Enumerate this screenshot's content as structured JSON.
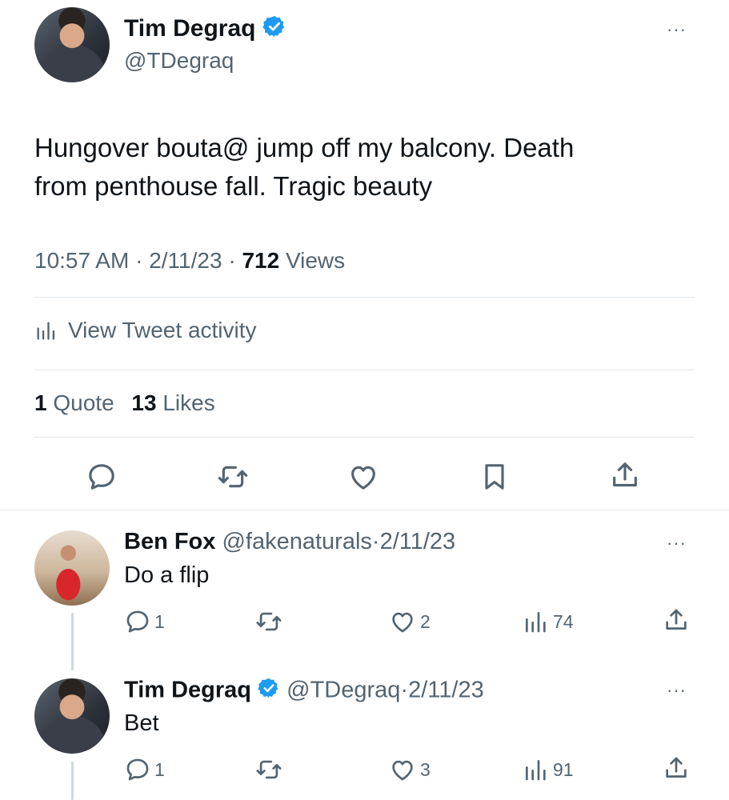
{
  "main_tweet": {
    "author_name": "Tim Degraq",
    "author_handle": "@TDegraq",
    "text_line1": "Hungover bouta@ jump off my balcony. Death",
    "text_line2": "from penthouse fall. Tragic beauty",
    "time": "10:57 AM",
    "date": "2/11/23",
    "views_count": "712",
    "views_label": "Views",
    "activity_label": "View Tweet activity",
    "quotes_count": "1",
    "quotes_label": "Quote",
    "likes_count": "13",
    "likes_label": "Likes"
  },
  "replies": [
    {
      "author_name": "Ben Fox",
      "author_handle": "@fakenaturals",
      "date": "2/11/23",
      "text": "Do a flip",
      "reply_count": "1",
      "like_count": "2",
      "view_count": "74",
      "verified": false
    },
    {
      "author_name": "Tim Degraq",
      "author_handle": "@TDegraq",
      "date": "2/11/23",
      "text": "Bet",
      "reply_count": "1",
      "like_count": "3",
      "view_count": "91",
      "verified": true
    }
  ],
  "symbols": {
    "separator": "·",
    "more": "···"
  },
  "colors": {
    "text": "#0f1419",
    "muted": "#536471",
    "verified": "#1d9bf0",
    "divider": "#e1e6ea"
  },
  "icons": [
    "verified-badge-icon",
    "more-icon",
    "analytics-icon",
    "reply-icon",
    "retweet-icon",
    "like-icon",
    "bookmark-icon",
    "share-icon"
  ]
}
